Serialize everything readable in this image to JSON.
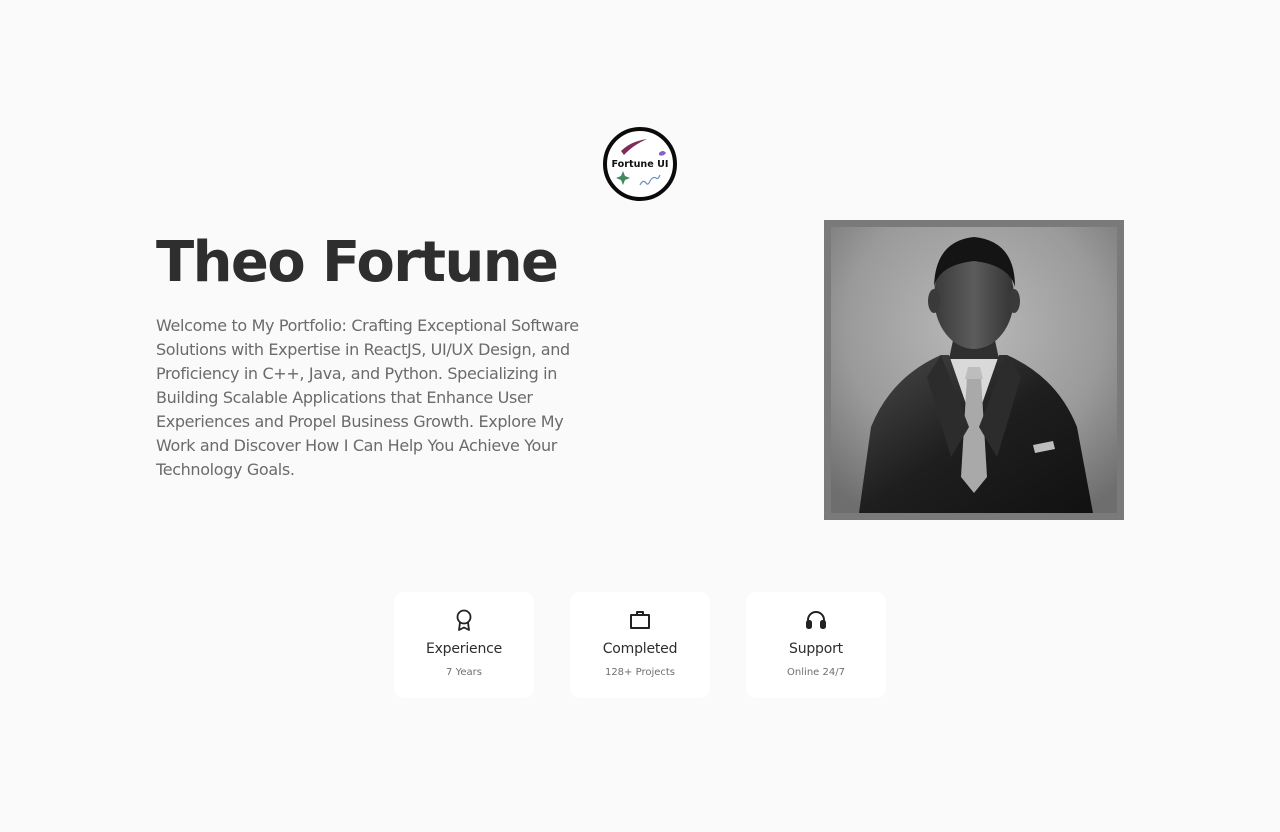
{
  "logo": {
    "text": "Fortune UI",
    "icon": "fortune-ui-logo"
  },
  "hero": {
    "name": "Theo Fortune",
    "description": "Welcome to My Portfolio: Crafting Exceptional Software Solutions with Expertise in ReactJS, UI/UX Design, and Proficiency in C++, Java, and Python. Specializing in Building Scalable Applications that Enhance User Experiences and Propel Business Growth. Explore My Work and Discover How I Can Help You Achieve Your Technology Goals."
  },
  "portrait": {
    "icon": "profile-photo"
  },
  "stats": [
    {
      "title": "Experience",
      "value": "7 Years",
      "icon": "award-icon"
    },
    {
      "title": "Completed",
      "value": "128+ Projects",
      "icon": "briefcase-icon"
    },
    {
      "title": "Support",
      "value": "Online 24/7",
      "icon": "headset-icon"
    }
  ],
  "colors": {
    "background": "#fafafa",
    "heading": "#2e2e2e",
    "body_text": "#6b6b6b",
    "card_bg": "#ffffff",
    "photo_frame": "#7a7a7a"
  }
}
